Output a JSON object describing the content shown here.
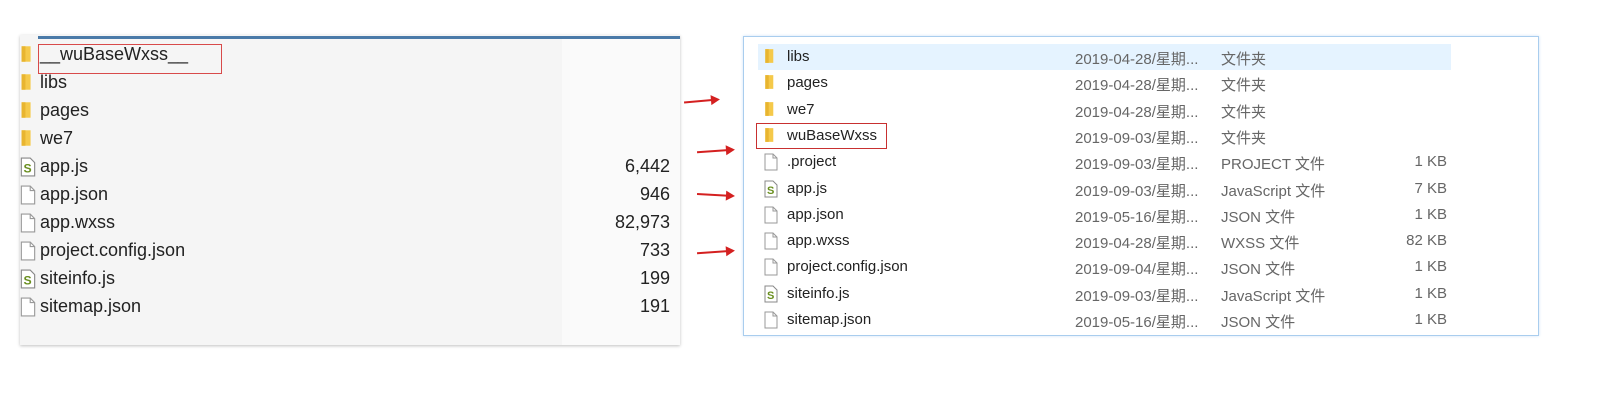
{
  "left_panel": {
    "items": [
      {
        "name": "__wuBaseWxss__",
        "icon": "folder-icon",
        "size": ""
      },
      {
        "name": "libs",
        "icon": "folder-icon",
        "size": ""
      },
      {
        "name": "pages",
        "icon": "folder-icon",
        "size": ""
      },
      {
        "name": "we7",
        "icon": "folder-icon",
        "size": ""
      },
      {
        "name": "app.js",
        "icon": "script-file-icon",
        "size": "6,442"
      },
      {
        "name": "app.json",
        "icon": "file-icon",
        "size": "946"
      },
      {
        "name": "app.wxss",
        "icon": "file-icon",
        "size": "82,973"
      },
      {
        "name": "project.config.json",
        "icon": "file-icon",
        "size": "733"
      },
      {
        "name": "siteinfo.js",
        "icon": "script-file-icon",
        "size": "199"
      },
      {
        "name": "sitemap.json",
        "icon": "file-icon",
        "size": "191"
      }
    ]
  },
  "right_panel": {
    "items": [
      {
        "name": "libs",
        "icon": "folder-icon",
        "date": "2019-04-28/星期...",
        "type": "文件夹",
        "size": ""
      },
      {
        "name": "pages",
        "icon": "folder-icon",
        "date": "2019-04-28/星期...",
        "type": "文件夹",
        "size": ""
      },
      {
        "name": "we7",
        "icon": "folder-icon",
        "date": "2019-04-28/星期...",
        "type": "文件夹",
        "size": ""
      },
      {
        "name": "wuBaseWxss",
        "icon": "folder-icon",
        "date": "2019-09-03/星期...",
        "type": "文件夹",
        "size": ""
      },
      {
        "name": ".project",
        "icon": "file-icon",
        "date": "2019-09-03/星期...",
        "type": "PROJECT 文件",
        "size": "1 KB"
      },
      {
        "name": "app.js",
        "icon": "script-file-icon",
        "date": "2019-09-03/星期...",
        "type": "JavaScript 文件",
        "size": "7 KB"
      },
      {
        "name": "app.json",
        "icon": "file-icon",
        "date": "2019-05-16/星期...",
        "type": "JSON 文件",
        "size": "1 KB"
      },
      {
        "name": "app.wxss",
        "icon": "file-icon",
        "date": "2019-04-28/星期...",
        "type": "WXSS 文件",
        "size": "82 KB"
      },
      {
        "name": "project.config.json",
        "icon": "file-icon",
        "date": "2019-09-04/星期...",
        "type": "JSON 文件",
        "size": "1 KB"
      },
      {
        "name": "siteinfo.js",
        "icon": "script-file-icon",
        "date": "2019-09-03/星期...",
        "type": "JavaScript 文件",
        "size": "1 KB"
      },
      {
        "name": "sitemap.json",
        "icon": "file-icon",
        "date": "2019-05-16/星期...",
        "type": "JSON 文件",
        "size": "1 KB"
      }
    ]
  },
  "colors": {
    "highlight": "#d84a4a",
    "arrow": "#d42020",
    "selected_row": "#e5f3ff"
  }
}
